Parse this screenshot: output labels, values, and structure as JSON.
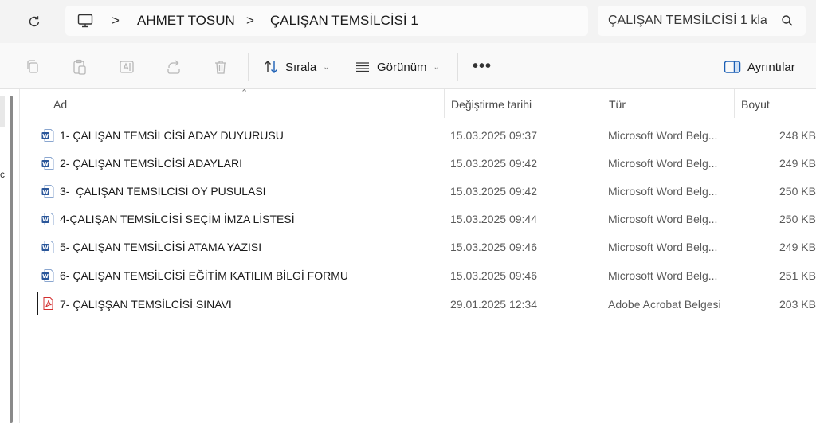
{
  "address_bar": {
    "breadcrumbs": [
      "AHMET TOSUN",
      "ÇALIŞAN TEMSİLCİSİ 1"
    ],
    "separator": ">"
  },
  "search": {
    "placeholder": "ÇALIŞAN TEMSİLCİSİ 1 kla"
  },
  "toolbar": {
    "sort_label": "Sırala",
    "view_label": "Görünüm",
    "more_label": "•••",
    "details_label": "Ayrıntılar"
  },
  "nav": {
    "hint": "c"
  },
  "columns": {
    "name": "Ad",
    "date": "Değiştirme tarihi",
    "type": "Tür",
    "size": "Boyut"
  },
  "files": [
    {
      "name": "1- ÇALIŞAN TEMSİLCİSİ ADAY DUYURUSU",
      "date": "15.03.2025 09:37",
      "type": "Microsoft Word Belg...",
      "size": "248 KB",
      "icon": "word-icon"
    },
    {
      "name": "2- ÇALIŞAN TEMSİLCİSİ ADAYLARI",
      "date": "15.03.2025 09:42",
      "type": "Microsoft Word Belg...",
      "size": "249 KB",
      "icon": "word-icon"
    },
    {
      "name": "3-  ÇALIŞAN TEMSİLCİSİ OY PUSULASI",
      "date": "15.03.2025 09:42",
      "type": "Microsoft Word Belg...",
      "size": "250 KB",
      "icon": "word-icon"
    },
    {
      "name": "4-ÇALIŞAN TEMSİLCİSİ SEÇİM İMZA LİSTESİ",
      "date": "15.03.2025 09:44",
      "type": "Microsoft Word Belg...",
      "size": "250 KB",
      "icon": "word-icon"
    },
    {
      "name": "5- ÇALIŞAN TEMSİLCİSİ ATAMA YAZISI",
      "date": "15.03.2025 09:46",
      "type": "Microsoft Word Belg...",
      "size": "249 KB",
      "icon": "word-icon"
    },
    {
      "name": "6- ÇALIŞAN TEMSİLCİSİ EĞİTİM KATILIM BİLGİ FORMU",
      "date": "15.03.2025 09:46",
      "type": "Microsoft Word Belg...",
      "size": "251 KB",
      "icon": "word-icon"
    },
    {
      "name": "7- ÇALIŞŞAN TEMSİLCİSİ SINAVI",
      "date": "29.01.2025 12:34",
      "type": "Adobe Acrobat Belgesi",
      "size": "203 KB",
      "icon": "pdf-icon",
      "selected": true
    }
  ],
  "colors": {
    "word_blue": "#2b579a",
    "pdf_red": "#d32f2f",
    "details_blue": "#1b5fb5"
  }
}
